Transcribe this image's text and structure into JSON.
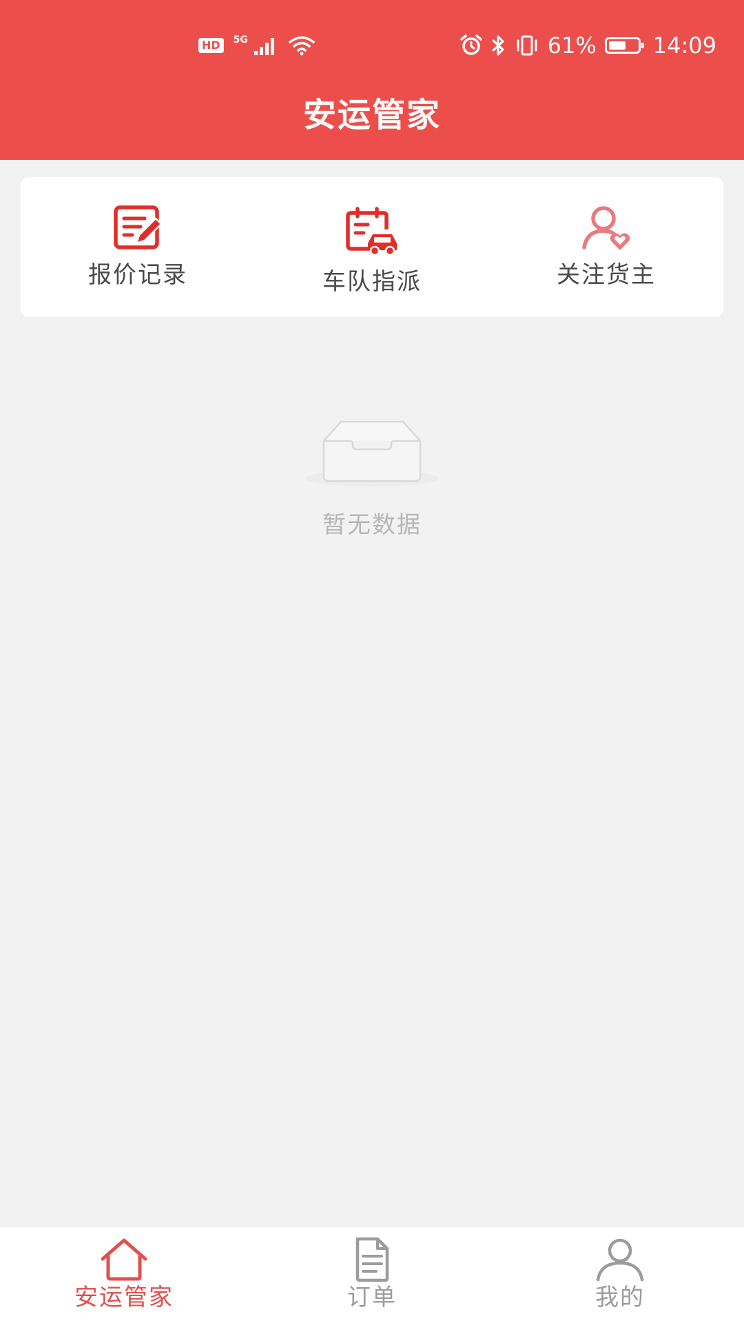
{
  "colors": {
    "header_bg": "#ec4f4b",
    "page_bg": "#f2f2f2",
    "accent": "#e1504c",
    "icon_red": "#e02e2a",
    "icon_pink": "#e97a80",
    "text_dark": "#4a4a4a",
    "text_muted": "#b6b6b6",
    "tab_inactive": "#9c9c9c"
  },
  "status_bar": {
    "hd": "HD",
    "network": "5G",
    "battery_text": "61%",
    "battery_level": 0.61,
    "time": "14:09",
    "icons": [
      "signal-icon",
      "wifi-icon",
      "alarm-icon",
      "bluetooth-icon",
      "vibrate-icon",
      "battery-icon"
    ]
  },
  "header": {
    "title": "安运管家"
  },
  "quick_actions": [
    {
      "label": "报价记录",
      "icon": "quote-record-icon"
    },
    {
      "label": "车队指派",
      "icon": "fleet-dispatch-icon"
    },
    {
      "label": "关注货主",
      "icon": "follow-shipper-icon"
    }
  ],
  "empty_state": {
    "text": "暂无数据",
    "icon": "empty-inbox-icon"
  },
  "tabbar": {
    "active_index": 0,
    "tabs": [
      {
        "label": "安运管家",
        "icon": "home-icon"
      },
      {
        "label": "订单",
        "icon": "document-icon"
      },
      {
        "label": "我的",
        "icon": "user-icon"
      }
    ]
  }
}
